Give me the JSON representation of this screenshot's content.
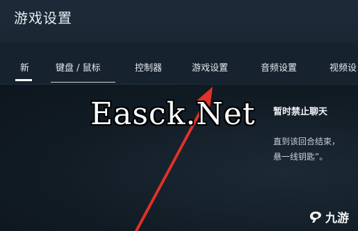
{
  "header": {
    "title": "游戏设置"
  },
  "tabs": [
    {
      "label": "新"
    },
    {
      "label": "键盘 / 鼠标"
    },
    {
      "label": "控制器"
    },
    {
      "label": "游戏设置"
    },
    {
      "label": "音频设置"
    },
    {
      "label": "视频设"
    }
  ],
  "watermark": {
    "text": "Easck.Net"
  },
  "panel": {
    "title": "暂时禁止聊天",
    "desc_line1": "直到该回合结束，",
    "desc_line2": "悬一线钥匙”。"
  },
  "logo": {
    "text": "九游",
    "icon": "nine-game-logo-icon"
  },
  "colors": {
    "annotation_arrow": "#e0312a",
    "active_tab_underline": "#ffffff"
  }
}
